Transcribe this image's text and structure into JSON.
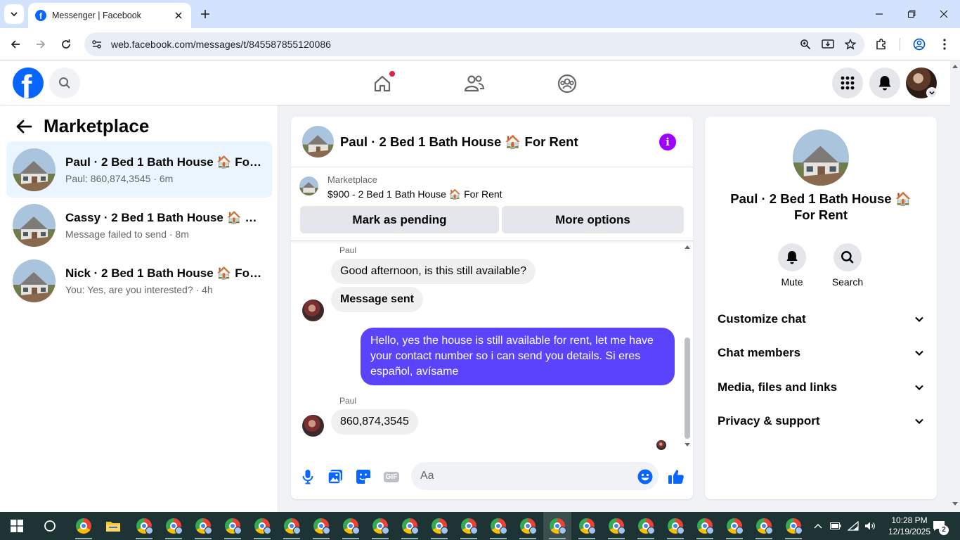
{
  "browser": {
    "tab_title": "Messenger | Facebook",
    "url": "web.facebook.com/messages/t/845587855120086"
  },
  "left_panel": {
    "title": "Marketplace",
    "conversations": [
      {
        "name": "Paul · 2 Bed 1 Bath House 🏠 For R...",
        "preview": "Paul: 860,874,3545 · 6m",
        "active": true
      },
      {
        "name": "Cassy · 2 Bed 1 Bath House 🏠 For ...",
        "preview": "Message failed to send · 8m",
        "active": false
      },
      {
        "name": "Nick · 2 Bed 1 Bath House 🏠 For R...",
        "preview": "You: Yes, are you interested? · 4h",
        "active": false
      }
    ]
  },
  "chat": {
    "title": "Paul · 2 Bed 1 Bath House 🏠 For Rent",
    "listing": {
      "label": "Marketplace",
      "title": "$900 - 2 Bed 1 Bath House 🏠 For Rent",
      "btn_pending": "Mark as pending",
      "btn_more": "More options"
    },
    "messages": [
      {
        "sender": "Paul",
        "text": "Good afternoon, is this still available?"
      },
      {
        "text": "Message sent"
      },
      {
        "text": "Hello, yes the house is still available for rent, let me have your contact number so i can send you  details. Si eres español, avísame"
      },
      {
        "sender": "Paul",
        "text": "860,874,3545"
      }
    ],
    "composer_placeholder": "Aa"
  },
  "info_panel": {
    "name": "Paul · 2 Bed 1 Bath House 🏠 For Rent",
    "actions": [
      {
        "label": "Mute",
        "icon": "bell-icon"
      },
      {
        "label": "Search",
        "icon": "search-icon"
      }
    ],
    "sections": [
      "Customize chat",
      "Chat members",
      "Media, files and links",
      "Privacy & support"
    ]
  },
  "taskbar": {
    "time": "10:28 PM",
    "date": "12/19/2025",
    "notifications": "2"
  },
  "colors": {
    "fb_blue": "#0866ff",
    "outgoing_bubble": "#5b43fb",
    "info_purple": "#a100ff",
    "notification_red": "#e41e3f"
  }
}
